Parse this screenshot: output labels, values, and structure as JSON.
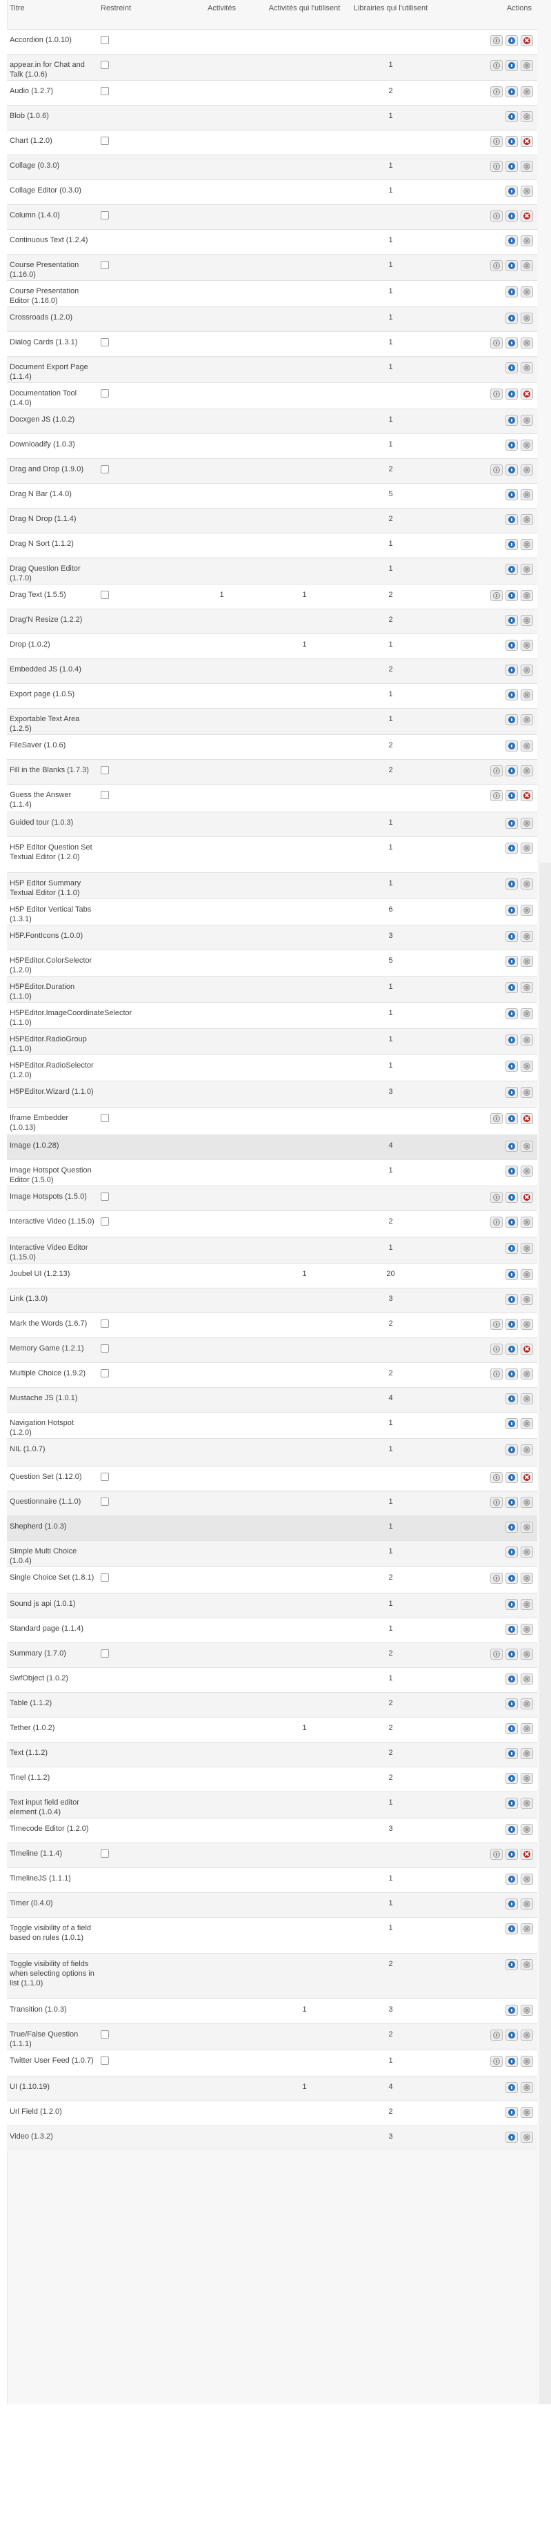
{
  "columns": {
    "title": "Titre",
    "restricted": "Restreint",
    "activities": "Activités",
    "activities_using": "Activités qui l'utilisent",
    "libraries_using": "Librairies qui l'utilisent",
    "actions": "Actions"
  },
  "colors": {
    "info": "#2b70b4",
    "delete": "#c01e1e",
    "row_alt": "#f4f4f4"
  },
  "icons": {
    "upgrade": "upgrade-icon",
    "info": "info-icon",
    "delete": "delete-icon"
  },
  "rows": [
    {
      "title": "Accordion (1.0.10)",
      "restricted": true,
      "activities": "",
      "activities_using": "",
      "libraries_using": "",
      "upgrade": true,
      "delete": true,
      "h": 36
    },
    {
      "title": "appear.in for Chat and Talk (1.0.6)",
      "restricted": true,
      "activities": "",
      "activities_using": "",
      "libraries_using": "1",
      "upgrade": true,
      "delete": false,
      "h": 38
    },
    {
      "title": "Audio (1.2.7)",
      "restricted": true,
      "activities": "",
      "activities_using": "",
      "libraries_using": "2",
      "upgrade": true,
      "delete": false,
      "h": 36
    },
    {
      "title": "Blob (1.0.6)",
      "restricted": false,
      "activities": "",
      "activities_using": "",
      "libraries_using": "1",
      "upgrade": false,
      "delete": false,
      "h": 36
    },
    {
      "title": "Chart (1.2.0)",
      "restricted": true,
      "activities": "",
      "activities_using": "",
      "libraries_using": "",
      "upgrade": true,
      "delete": true,
      "h": 36
    },
    {
      "title": "Collage (0.3.0)",
      "restricted": false,
      "activities": "",
      "activities_using": "",
      "libraries_using": "1",
      "upgrade": true,
      "delete": false,
      "h": 36
    },
    {
      "title": "Collage Editor (0.3.0)",
      "restricted": false,
      "activities": "",
      "activities_using": "",
      "libraries_using": "1",
      "upgrade": false,
      "delete": false,
      "h": 36
    },
    {
      "title": "Column (1.4.0)",
      "restricted": true,
      "activities": "",
      "activities_using": "",
      "libraries_using": "",
      "upgrade": true,
      "delete": true,
      "h": 36
    },
    {
      "title": "Continuous Text (1.2.4)",
      "restricted": false,
      "activities": "",
      "activities_using": "",
      "libraries_using": "1",
      "upgrade": false,
      "delete": false,
      "h": 36
    },
    {
      "title": "Course Presentation (1.16.0)",
      "restricted": true,
      "activities": "",
      "activities_using": "",
      "libraries_using": "1",
      "upgrade": true,
      "delete": false,
      "h": 38
    },
    {
      "title": "Course Presentation Editor (1.16.0)",
      "restricted": false,
      "activities": "",
      "activities_using": "",
      "libraries_using": "1",
      "upgrade": false,
      "delete": false,
      "h": 38
    },
    {
      "title": "Crossroads (1.2.0)",
      "restricted": false,
      "activities": "",
      "activities_using": "",
      "libraries_using": "1",
      "upgrade": false,
      "delete": false,
      "h": 36
    },
    {
      "title": "Dialog Cards (1.3.1)",
      "restricted": true,
      "activities": "",
      "activities_using": "",
      "libraries_using": "1",
      "upgrade": true,
      "delete": false,
      "h": 36
    },
    {
      "title": "Document Export Page (1.1.4)",
      "restricted": false,
      "activities": "",
      "activities_using": "",
      "libraries_using": "1",
      "upgrade": false,
      "delete": false,
      "h": 38
    },
    {
      "title": "Documentation Tool (1.4.0)",
      "restricted": true,
      "activities": "",
      "activities_using": "",
      "libraries_using": "",
      "upgrade": true,
      "delete": true,
      "h": 38
    },
    {
      "title": "Docxgen JS (1.0.2)",
      "restricted": false,
      "activities": "",
      "activities_using": "",
      "libraries_using": "1",
      "upgrade": false,
      "delete": false,
      "h": 36
    },
    {
      "title": "Downloadify (1.0.3)",
      "restricted": false,
      "activities": "",
      "activities_using": "",
      "libraries_using": "1",
      "upgrade": false,
      "delete": false,
      "h": 36
    },
    {
      "title": "Drag and Drop (1.9.0)",
      "restricted": true,
      "activities": "",
      "activities_using": "",
      "libraries_using": "2",
      "upgrade": true,
      "delete": false,
      "h": 36
    },
    {
      "title": "Drag N Bar (1.4.0)",
      "restricted": false,
      "activities": "",
      "activities_using": "",
      "libraries_using": "5",
      "upgrade": false,
      "delete": false,
      "h": 36
    },
    {
      "title": "Drag N Drop (1.1.4)",
      "restricted": false,
      "activities": "",
      "activities_using": "",
      "libraries_using": "2",
      "upgrade": false,
      "delete": false,
      "h": 36
    },
    {
      "title": "Drag N Sort (1.1.2)",
      "restricted": false,
      "activities": "",
      "activities_using": "",
      "libraries_using": "1",
      "upgrade": false,
      "delete": false,
      "h": 36
    },
    {
      "title": "Drag Question Editor (1.7.0)",
      "restricted": false,
      "activities": "",
      "activities_using": "",
      "libraries_using": "1",
      "upgrade": false,
      "delete": false,
      "h": 38
    },
    {
      "title": "Drag Text (1.5.5)",
      "restricted": true,
      "activities": "1",
      "activities_using": "1",
      "libraries_using": "2",
      "upgrade": true,
      "delete": false,
      "h": 36
    },
    {
      "title": "Drag'N Resize (1.2.2)",
      "restricted": false,
      "activities": "",
      "activities_using": "",
      "libraries_using": "2",
      "upgrade": false,
      "delete": false,
      "h": 36
    },
    {
      "title": "Drop (1.0.2)",
      "restricted": false,
      "activities": "",
      "activities_using": "1",
      "libraries_using": "1",
      "upgrade": false,
      "delete": false,
      "h": 36
    },
    {
      "title": "Embedded JS (1.0.4)",
      "restricted": false,
      "activities": "",
      "activities_using": "",
      "libraries_using": "2",
      "upgrade": false,
      "delete": false,
      "h": 36
    },
    {
      "title": "Export page (1.0.5)",
      "restricted": false,
      "activities": "",
      "activities_using": "",
      "libraries_using": "1",
      "upgrade": false,
      "delete": false,
      "h": 36
    },
    {
      "title": "Exportable Text Area (1.2.5)",
      "restricted": false,
      "activities": "",
      "activities_using": "",
      "libraries_using": "1",
      "upgrade": false,
      "delete": false,
      "h": 38
    },
    {
      "title": "FileSaver (1.0.6)",
      "restricted": false,
      "activities": "",
      "activities_using": "",
      "libraries_using": "2",
      "upgrade": false,
      "delete": false,
      "h": 36
    },
    {
      "title": "Fill in the Blanks (1.7.3)",
      "restricted": true,
      "activities": "",
      "activities_using": "",
      "libraries_using": "2",
      "upgrade": true,
      "delete": false,
      "h": 36
    },
    {
      "title": "Guess the Answer (1.1.4)",
      "restricted": true,
      "activities": "",
      "activities_using": "",
      "libraries_using": "",
      "upgrade": true,
      "delete": true,
      "h": 40
    },
    {
      "title": "Guided tour (1.0.3)",
      "restricted": false,
      "activities": "",
      "activities_using": "",
      "libraries_using": "1",
      "upgrade": false,
      "delete": false,
      "h": 36
    },
    {
      "title": "H5P Editor Question Set Textual Editor (1.2.0)",
      "restricted": false,
      "activities": "",
      "activities_using": "",
      "libraries_using": "1",
      "upgrade": false,
      "delete": false,
      "h": 52
    },
    {
      "title": "H5P Editor Summary Textual Editor (1.1.0)",
      "restricted": false,
      "activities": "",
      "activities_using": "",
      "libraries_using": "1",
      "upgrade": false,
      "delete": false,
      "h": 38
    },
    {
      "title": "H5P Editor Vertical Tabs (1.3.1)",
      "restricted": false,
      "activities": "",
      "activities_using": "",
      "libraries_using": "6",
      "upgrade": false,
      "delete": false,
      "h": 38
    },
    {
      "title": "H5P.FontIcons (1.0.0)",
      "restricted": false,
      "activities": "",
      "activities_using": "",
      "libraries_using": "3",
      "upgrade": false,
      "delete": false,
      "h": 36
    },
    {
      "title": "H5PEditor.ColorSelector (1.2.0)",
      "restricted": false,
      "activities": "",
      "activities_using": "",
      "libraries_using": "5",
      "upgrade": false,
      "delete": false,
      "h": 38
    },
    {
      "title": "H5PEditor.Duration (1.1.0)",
      "restricted": false,
      "activities": "",
      "activities_using": "",
      "libraries_using": "1",
      "upgrade": false,
      "delete": false,
      "h": 38
    },
    {
      "title": "H5PEditor.ImageCoordinateSelector (1.1.0)",
      "restricted": false,
      "activities": "",
      "activities_using": "",
      "libraries_using": "1",
      "upgrade": false,
      "delete": false,
      "h": 38
    },
    {
      "title": "H5PEditor.RadioGroup (1.1.0)",
      "restricted": false,
      "activities": "",
      "activities_using": "",
      "libraries_using": "1",
      "upgrade": false,
      "delete": false,
      "h": 38
    },
    {
      "title": "H5PEditor.RadioSelector (1.2.0)",
      "restricted": false,
      "activities": "",
      "activities_using": "",
      "libraries_using": "1",
      "upgrade": false,
      "delete": false,
      "h": 38
    },
    {
      "title": "H5PEditor.Wizard (1.1.0)",
      "restricted": false,
      "activities": "",
      "activities_using": "",
      "libraries_using": "3",
      "upgrade": false,
      "delete": false,
      "h": 38
    },
    {
      "title": "Iframe Embedder (1.0.13)",
      "restricted": true,
      "activities": "",
      "activities_using": "",
      "libraries_using": "",
      "upgrade": true,
      "delete": true,
      "h": 40
    },
    {
      "title": "Image (1.0.28)",
      "restricted": false,
      "activities": "",
      "activities_using": "",
      "libraries_using": "4",
      "upgrade": false,
      "delete": false,
      "h": 36,
      "hl": true
    },
    {
      "title": "Image Hotspot Question Editor (1.5.0)",
      "restricted": false,
      "activities": "",
      "activities_using": "",
      "libraries_using": "1",
      "upgrade": false,
      "delete": false,
      "h": 38
    },
    {
      "title": "Image Hotspots (1.5.0)",
      "restricted": true,
      "activities": "",
      "activities_using": "",
      "libraries_using": "",
      "upgrade": true,
      "delete": true,
      "h": 36
    },
    {
      "title": "Interactive Video (1.15.0)",
      "restricted": true,
      "activities": "",
      "activities_using": "",
      "libraries_using": "2",
      "upgrade": true,
      "delete": false,
      "h": 38
    },
    {
      "title": "Interactive Video Editor (1.15.0)",
      "restricted": false,
      "activities": "",
      "activities_using": "",
      "libraries_using": "1",
      "upgrade": false,
      "delete": false,
      "h": 38
    },
    {
      "title": "Joubel UI (1.2.13)",
      "restricted": false,
      "activities": "",
      "activities_using": "1",
      "libraries_using": "20",
      "upgrade": false,
      "delete": false,
      "h": 36
    },
    {
      "title": "Link (1.3.0)",
      "restricted": false,
      "activities": "",
      "activities_using": "",
      "libraries_using": "3",
      "upgrade": false,
      "delete": false,
      "h": 36
    },
    {
      "title": "Mark the Words (1.6.7)",
      "restricted": true,
      "activities": "",
      "activities_using": "",
      "libraries_using": "2",
      "upgrade": true,
      "delete": false,
      "h": 36
    },
    {
      "title": "Memory Game (1.2.1)",
      "restricted": true,
      "activities": "",
      "activities_using": "",
      "libraries_using": "",
      "upgrade": true,
      "delete": true,
      "h": 36
    },
    {
      "title": "Multiple Choice (1.9.2)",
      "restricted": true,
      "activities": "",
      "activities_using": "",
      "libraries_using": "2",
      "upgrade": true,
      "delete": false,
      "h": 36
    },
    {
      "title": "Mustache JS (1.0.1)",
      "restricted": false,
      "activities": "",
      "activities_using": "",
      "libraries_using": "4",
      "upgrade": false,
      "delete": false,
      "h": 36
    },
    {
      "title": "Navigation Hotspot (1.2.0)",
      "restricted": false,
      "activities": "",
      "activities_using": "",
      "libraries_using": "1",
      "upgrade": false,
      "delete": false,
      "h": 38
    },
    {
      "title": "NIL (1.0.7)",
      "restricted": false,
      "activities": "",
      "activities_using": "",
      "libraries_using": "1",
      "upgrade": false,
      "delete": false,
      "h": 40
    },
    {
      "title": "Question Set (1.12.0)",
      "restricted": true,
      "activities": "",
      "activities_using": "",
      "libraries_using": "",
      "upgrade": true,
      "delete": true,
      "h": 36
    },
    {
      "title": "Questionnaire (1.1.0)",
      "restricted": true,
      "activities": "",
      "activities_using": "",
      "libraries_using": "1",
      "upgrade": true,
      "delete": false,
      "h": 36
    },
    {
      "title": "Shepherd (1.0.3)",
      "restricted": false,
      "activities": "",
      "activities_using": "",
      "libraries_using": "1",
      "upgrade": false,
      "delete": false,
      "h": 36,
      "hl": true
    },
    {
      "title": "Simple Multi Choice (1.0.4)",
      "restricted": false,
      "activities": "",
      "activities_using": "",
      "libraries_using": "1",
      "upgrade": false,
      "delete": false,
      "h": 38
    },
    {
      "title": "Single Choice Set (1.8.1)",
      "restricted": true,
      "activities": "",
      "activities_using": "",
      "libraries_using": "2",
      "upgrade": true,
      "delete": false,
      "h": 38
    },
    {
      "title": "Sound js api (1.0.1)",
      "restricted": false,
      "activities": "",
      "activities_using": "",
      "libraries_using": "1",
      "upgrade": false,
      "delete": false,
      "h": 36
    },
    {
      "title": "Standard page (1.1.4)",
      "restricted": false,
      "activities": "",
      "activities_using": "",
      "libraries_using": "1",
      "upgrade": false,
      "delete": false,
      "h": 36
    },
    {
      "title": "Summary (1.7.0)",
      "restricted": true,
      "activities": "",
      "activities_using": "",
      "libraries_using": "2",
      "upgrade": true,
      "delete": false,
      "h": 36
    },
    {
      "title": "SwfObject (1.0.2)",
      "restricted": false,
      "activities": "",
      "activities_using": "",
      "libraries_using": "1",
      "upgrade": false,
      "delete": false,
      "h": 36
    },
    {
      "title": "Table (1.1.2)",
      "restricted": false,
      "activities": "",
      "activities_using": "",
      "libraries_using": "2",
      "upgrade": false,
      "delete": false,
      "h": 36
    },
    {
      "title": "Tether (1.0.2)",
      "restricted": false,
      "activities": "",
      "activities_using": "1",
      "libraries_using": "2",
      "upgrade": false,
      "delete": false,
      "h": 36
    },
    {
      "title": "Text (1.1.2)",
      "restricted": false,
      "activities": "",
      "activities_using": "",
      "libraries_using": "2",
      "upgrade": false,
      "delete": false,
      "h": 36
    },
    {
      "title": "Tinel (1.1.2)",
      "restricted": false,
      "activities": "",
      "activities_using": "",
      "libraries_using": "2",
      "upgrade": false,
      "delete": false,
      "h": 36
    },
    {
      "title": "Text input field editor element (1.0.4)",
      "restricted": false,
      "activities": "",
      "activities_using": "",
      "libraries_using": "1",
      "upgrade": false,
      "delete": false,
      "h": 38
    },
    {
      "title": "Timecode Editor (1.2.0)",
      "restricted": false,
      "activities": "",
      "activities_using": "",
      "libraries_using": "3",
      "upgrade": false,
      "delete": false,
      "h": 36
    },
    {
      "title": "Timeline (1.1.4)",
      "restricted": true,
      "activities": "",
      "activities_using": "",
      "libraries_using": "",
      "upgrade": true,
      "delete": true,
      "h": 36
    },
    {
      "title": "TimelineJS (1.1.1)",
      "restricted": false,
      "activities": "",
      "activities_using": "",
      "libraries_using": "1",
      "upgrade": false,
      "delete": false,
      "h": 36
    },
    {
      "title": "Timer (0.4.0)",
      "restricted": false,
      "activities": "",
      "activities_using": "",
      "libraries_using": "1",
      "upgrade": false,
      "delete": false,
      "h": 36
    },
    {
      "title": "Toggle visibility of a field based on rules (1.0.1)",
      "restricted": false,
      "activities": "",
      "activities_using": "",
      "libraries_using": "1",
      "upgrade": false,
      "delete": false,
      "h": 52
    },
    {
      "title": "Toggle visibility of fields when selecting options in list (1.1.0)",
      "restricted": false,
      "activities": "",
      "activities_using": "",
      "libraries_using": "2",
      "upgrade": false,
      "delete": false,
      "h": 66
    },
    {
      "title": "Transition (1.0.3)",
      "restricted": false,
      "activities": "",
      "activities_using": "1",
      "libraries_using": "3",
      "upgrade": false,
      "delete": false,
      "h": 36
    },
    {
      "title": "True/False Question (1.1.1)",
      "restricted": true,
      "activities": "",
      "activities_using": "",
      "libraries_using": "2",
      "upgrade": true,
      "delete": false,
      "h": 38
    },
    {
      "title": "Twitter User Feed (1.0.7)",
      "restricted": true,
      "activities": "",
      "activities_using": "",
      "libraries_using": "1",
      "upgrade": true,
      "delete": false,
      "h": 38
    },
    {
      "title": "UI (1.10.19)",
      "restricted": false,
      "activities": "",
      "activities_using": "1",
      "libraries_using": "4",
      "upgrade": false,
      "delete": false,
      "h": 36
    },
    {
      "title": "Url Field (1.2.0)",
      "restricted": false,
      "activities": "",
      "activities_using": "",
      "libraries_using": "2",
      "upgrade": false,
      "delete": false,
      "h": 36
    },
    {
      "title": "Video (1.3.2)",
      "restricted": false,
      "activities": "",
      "activities_using": "",
      "libraries_using": "3",
      "upgrade": false,
      "delete": false,
      "h": 36
    }
  ]
}
